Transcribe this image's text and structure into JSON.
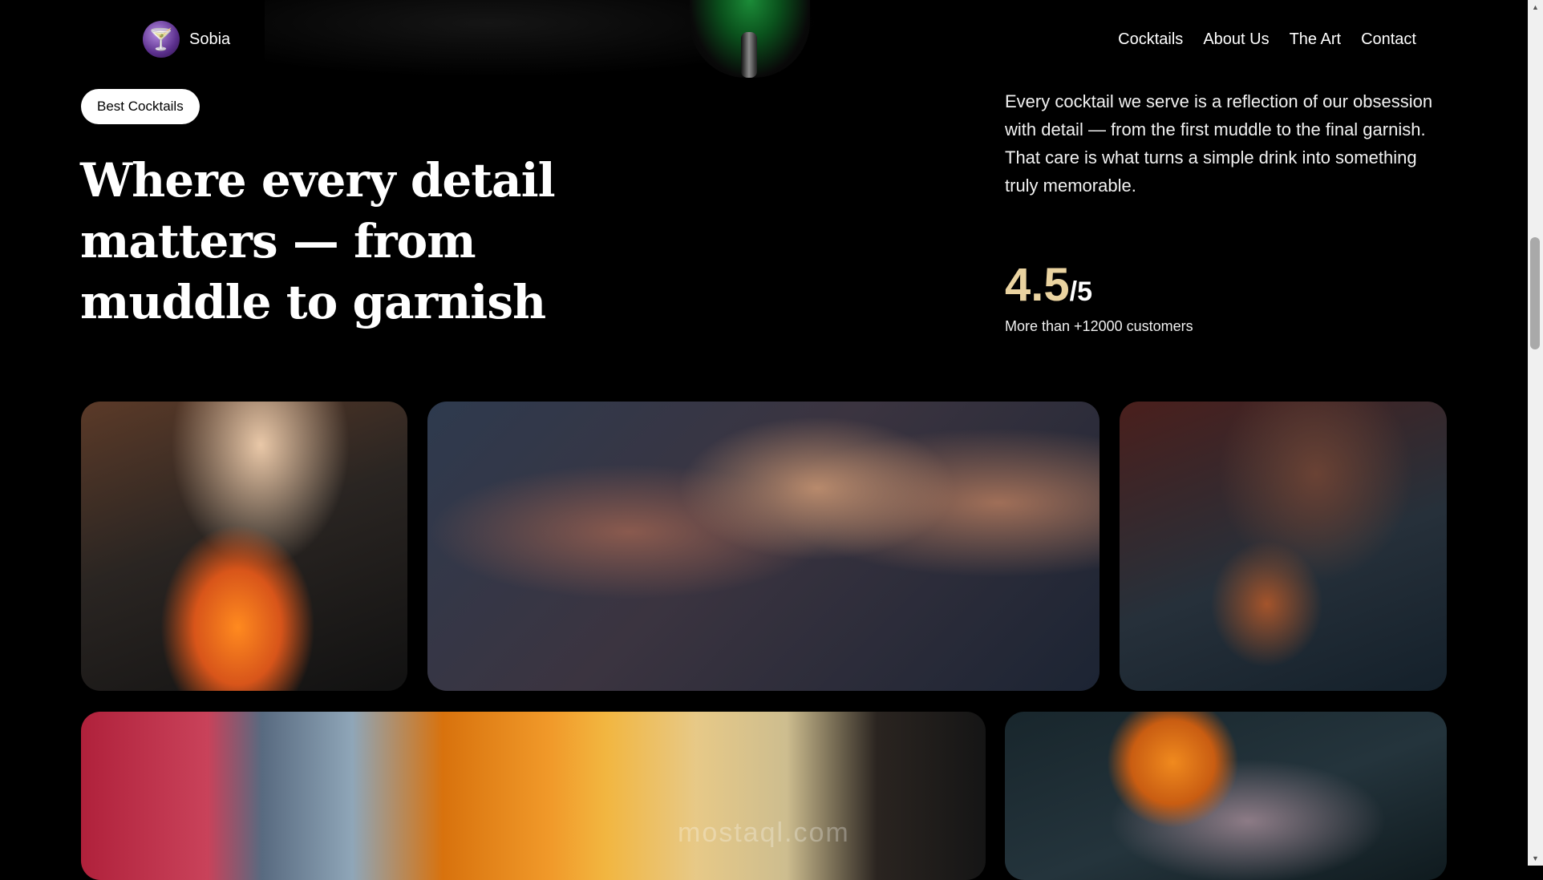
{
  "brand": {
    "name": "Sobia",
    "logo_icon": "cocktail-glass-icon"
  },
  "nav": {
    "items": [
      "Cocktails",
      "About Us",
      "The Art",
      "Contact"
    ]
  },
  "hero": {
    "badge": "Best Cocktails",
    "title": "Where every detail matters — from muddle to garnish",
    "description": "Every cocktail we serve is a reflection of our obsession with detail — from the first muddle to the final garnish. That care is what turns a simple drink into something truly memorable.",
    "rating_value": "4.5",
    "rating_scale": "/5",
    "rating_caption": "More than +12000 customers"
  },
  "gallery": {
    "items": [
      "bartender-garnishing-cocktail-photo",
      "friends-toasting-photo",
      "bartender-straining-martini-photo",
      "colorful-cocktail-row-photo",
      "citrus-cocktail-photo"
    ]
  },
  "colors": {
    "background": "#000000",
    "accent": "#ead3a0",
    "badge_bg": "#ffffff"
  },
  "watermark": "mostaql.com"
}
